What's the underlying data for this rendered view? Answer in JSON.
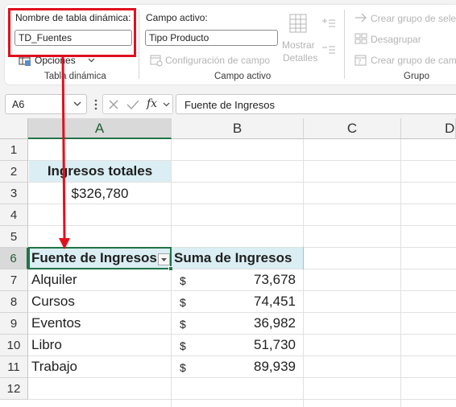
{
  "ribbon": {
    "pivot_name_label": "Nombre de tabla dinámica:",
    "pivot_name_value": "TD_Fuentes",
    "options_label": "Opciones",
    "group_pivot_label": "Tabla dinámica",
    "active_field_label": "Campo activo:",
    "active_field_value": "Tipo Producto",
    "field_settings_label": "Configuración de campo",
    "show_details_line1": "Mostrar",
    "show_details_line2": "Detalles",
    "group_active_field_label": "Campo activo",
    "create_group_selection_label": "Crear grupo de selección",
    "ungroup_label": "Desagrupar",
    "create_group_field_label": "Crear grupo de campo",
    "group_group_label": "Grupo"
  },
  "formula_bar": {
    "name_box": "A6",
    "fx_label": "fx",
    "formula_value": "Fuente de Ingresos"
  },
  "grid": {
    "columns": [
      "A",
      "B",
      "C",
      "D"
    ],
    "rows": [
      "1",
      "2",
      "3",
      "4",
      "5",
      "6",
      "7",
      "8",
      "9",
      "10",
      "11",
      "12"
    ],
    "total_label": "Ingresos totales",
    "total_value": "$326,780",
    "pivot_header_source": "Fuente de Ingresos",
    "pivot_header_sum": "Suma de Ingresos",
    "currency_symbol": "$",
    "pivot_rows": [
      {
        "source": "Alquiler",
        "value": "73,678"
      },
      {
        "source": "Cursos",
        "value": "74,451"
      },
      {
        "source": "Eventos",
        "value": "36,982"
      },
      {
        "source": "Libro",
        "value": "51,730"
      },
      {
        "source": "Trabajo",
        "value": "89,939"
      }
    ]
  },
  "colors": {
    "highlight": "#e0101e",
    "selection": "#217346",
    "header_fill": "#daeef3"
  }
}
